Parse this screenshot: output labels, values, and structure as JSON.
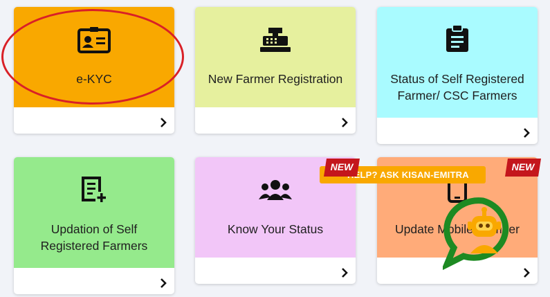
{
  "cards": [
    {
      "title": "e-KYC",
      "icon": "id-card-icon",
      "bg": "#f9a800"
    },
    {
      "title": "New Farmer Registration",
      "icon": "cash-register-icon",
      "bg": "#e6f09e"
    },
    {
      "title": "Status of Self Registered Farmer/ CSC Farmers",
      "icon": "clipboard-list-icon",
      "bg": "#a9fbff"
    },
    {
      "title": "Updation of Self Registered Farmers",
      "icon": "edit-list-icon",
      "bg": "#95ea8c"
    },
    {
      "title": "Know Your Status",
      "icon": "users-icon",
      "bg": "#f2c6f8"
    },
    {
      "title": "Update Mobile Number",
      "icon": "mobile-icon",
      "bg": "#ffab79"
    }
  ],
  "badges": {
    "new_label": "NEW"
  },
  "chat": {
    "help_label": "HELP? ASK KISAN-EMITRA"
  },
  "colors": {
    "accent": "#f9a800",
    "new_badge": "#c4161c",
    "highlight_ring": "#d92027",
    "bot_green": "#1d8a22"
  }
}
